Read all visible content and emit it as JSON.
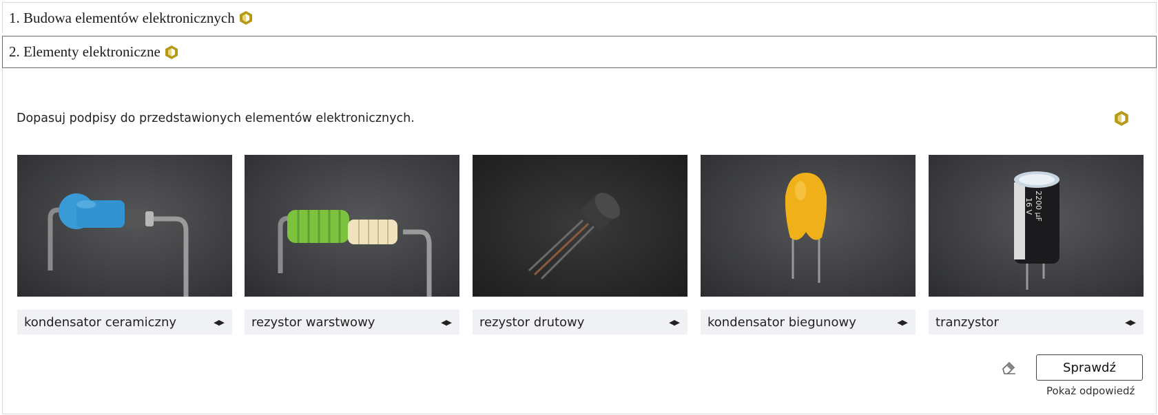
{
  "sections": [
    {
      "title": "1. Budowa elementów elektronicznych"
    },
    {
      "title": "2. Elementy elektroniczne"
    }
  ],
  "exercise": {
    "instruction": "Dopasuj podpisy do przedstawionych elementów elektronicznych.",
    "items": [
      {
        "image": "ceramic-capacitor-image",
        "label": "kondensator ceramiczny"
      },
      {
        "image": "film-resistor-image",
        "label": "rezystor warstwowy"
      },
      {
        "image": "transistor-image",
        "label": "rezystor drutowy"
      },
      {
        "image": "polar-capacitor-image",
        "label": "kondensator biegunowy"
      },
      {
        "image": "electrolytic-capacitor-image",
        "label": "tranzystor"
      }
    ],
    "check_label": "Sprawdź",
    "show_answer_label": "Pokaż odpowiedź",
    "capacitor_markings": [
      "2200 µF",
      "16 V"
    ]
  },
  "colors": {
    "accent": "#b59a1a",
    "label_bg": "#f0f1f4"
  }
}
